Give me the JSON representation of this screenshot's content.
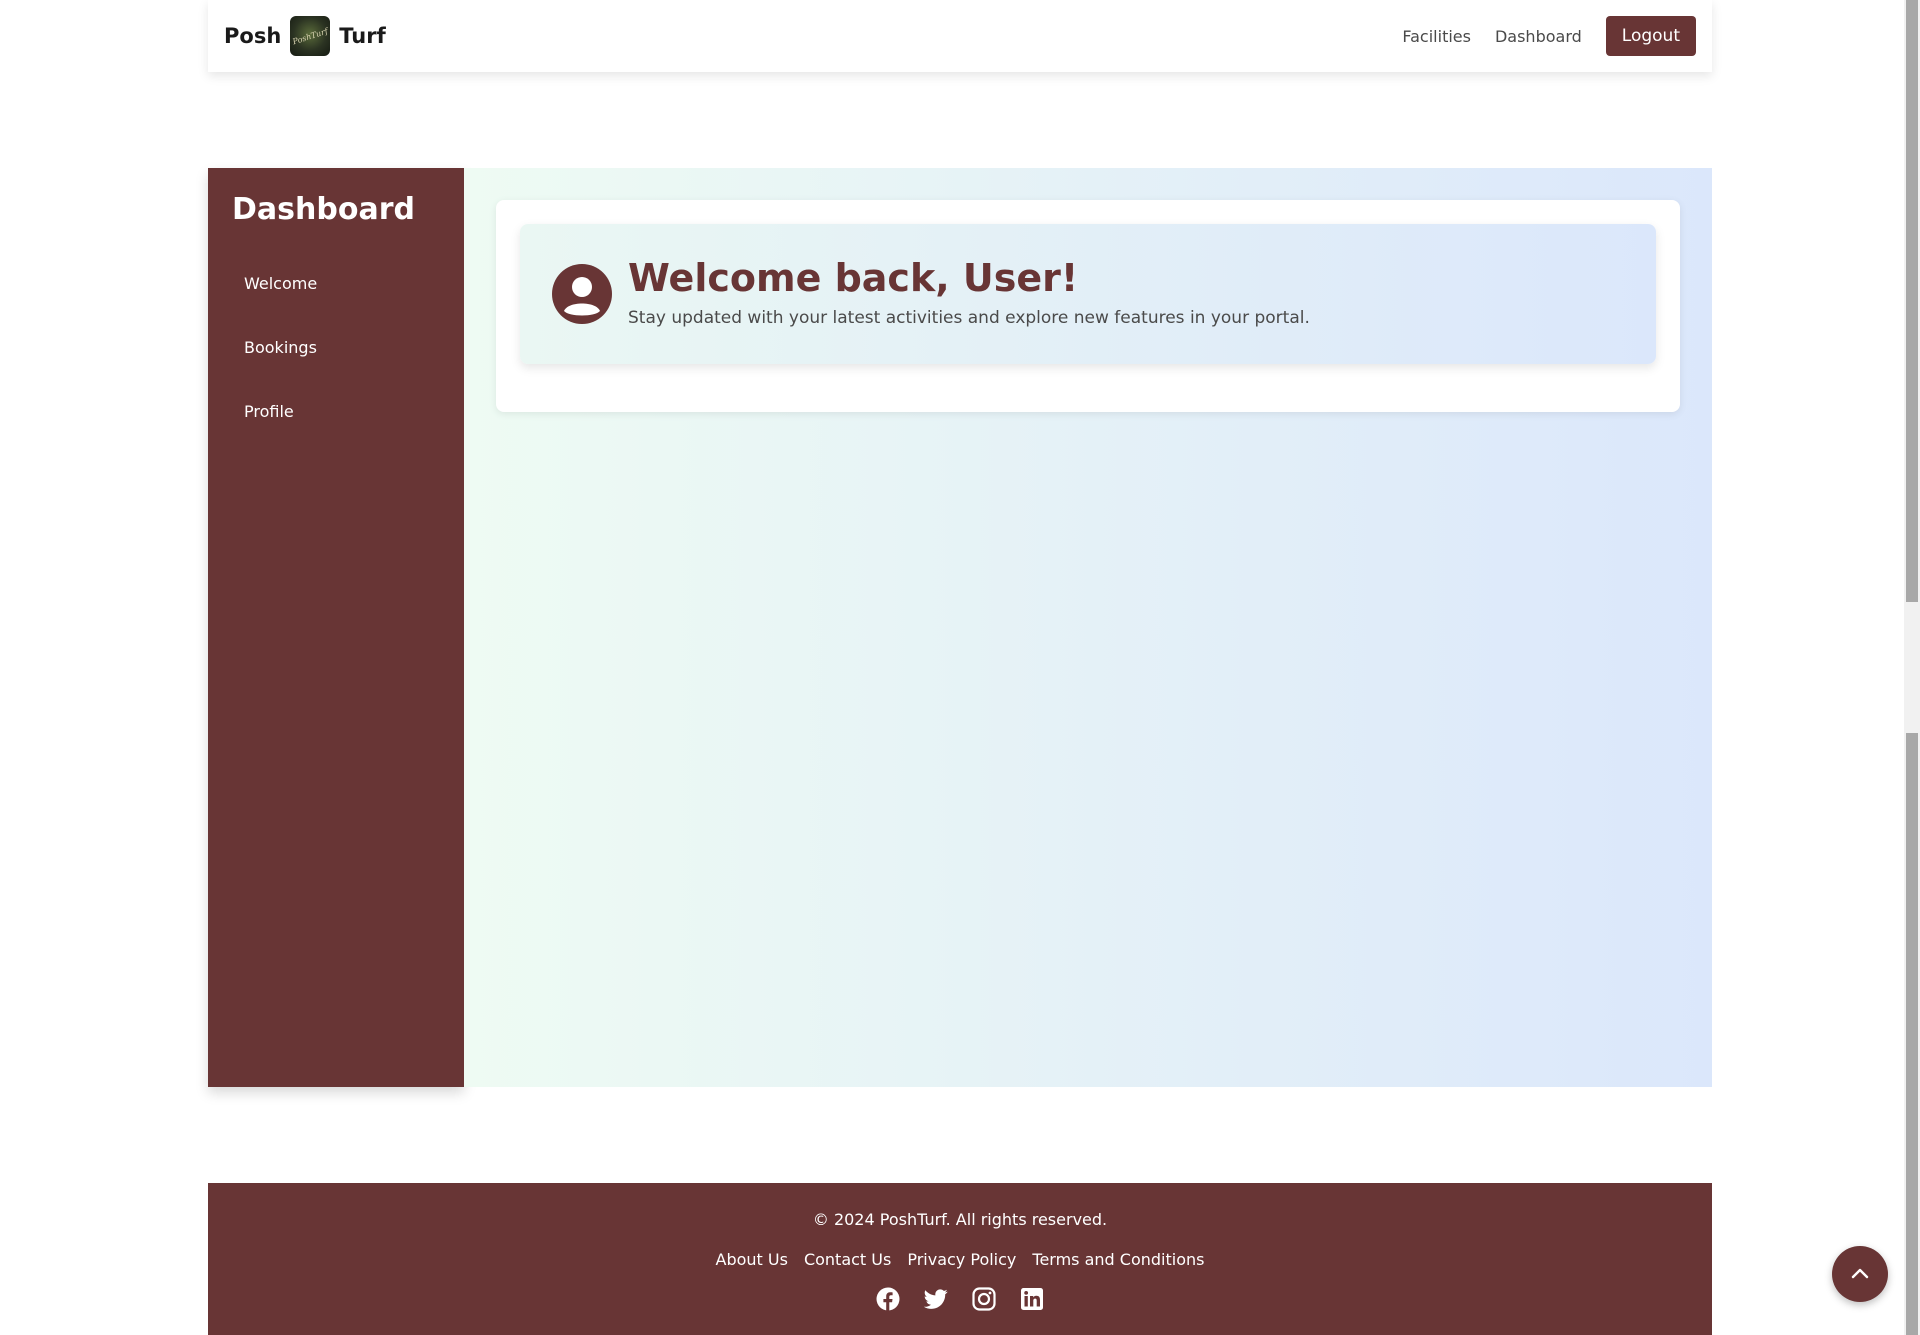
{
  "navbar": {
    "brand_left": "Posh",
    "brand_logo_text": "PoshTurf",
    "brand_right": "Turf",
    "links": [
      "Facilities",
      "Dashboard"
    ],
    "logout_label": "Logout"
  },
  "sidebar": {
    "title": "Dashboard",
    "items": [
      "Welcome",
      "Bookings",
      "Profile"
    ]
  },
  "welcome": {
    "title": "Welcome back, User!",
    "subtitle": "Stay updated with your latest activities and explore new features in your portal."
  },
  "footer": {
    "copyright": "© 2024 PoshTurf. All rights reserved.",
    "links": [
      "About Us",
      "Contact Us",
      "Privacy Policy",
      "Terms and Conditions"
    ],
    "social_icons": [
      "facebook-icon",
      "twitter-icon",
      "instagram-icon",
      "linkedin-icon"
    ]
  },
  "colors": {
    "brand": "#683535",
    "gradient_start": "#eefbf3",
    "gradient_end": "#dbe7fb"
  },
  "icons": {
    "avatar": "user-circle-icon",
    "back_to_top": "chevron-up-icon"
  }
}
